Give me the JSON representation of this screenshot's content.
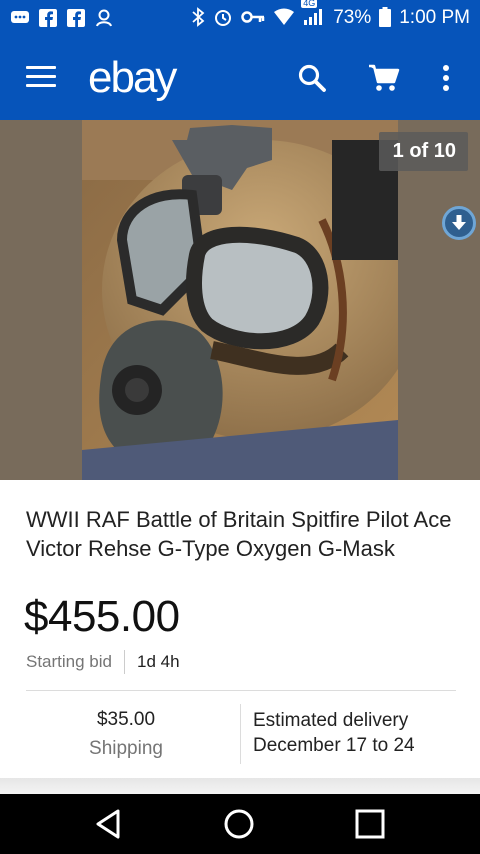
{
  "status_bar": {
    "network_label": "4G",
    "battery": "73%",
    "time": "1:00 PM"
  },
  "app_bar": {
    "logo_text": "ebay",
    "icons": [
      "menu-icon",
      "search-icon",
      "cart-icon",
      "more-vert-icon"
    ]
  },
  "gallery": {
    "counter": "1 of 10"
  },
  "listing": {
    "title": "WWII RAF Battle of Britain Spitfire Pilot Ace Victor Rehse G-Type Oxygen G-Mask",
    "price": "$455.00",
    "bid_label": "Starting bid",
    "time_left": "1d 4h",
    "shipping_amount": "$35.00",
    "shipping_label": "Shipping",
    "delivery_label": "Estimated delivery",
    "delivery_dates": "December 17 to 24"
  },
  "colors": {
    "brand_blue": "#0654ba",
    "text": "#222222",
    "muted": "#757575"
  }
}
